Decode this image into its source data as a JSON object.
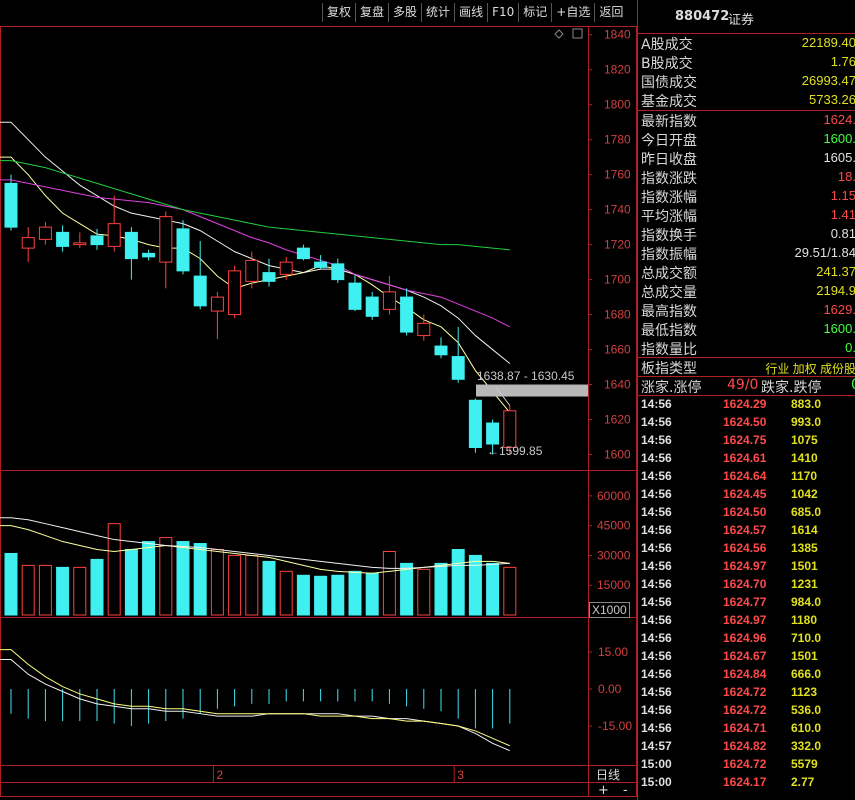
{
  "toolbar": [
    "复权",
    "复盘",
    "多股",
    "统计",
    "画线",
    "F10",
    "标记",
    "+自选",
    "返回"
  ],
  "chart_data": {
    "type": "candlestick",
    "price_axis": {
      "ticks": [
        1840,
        1820,
        1800,
        1780,
        1760,
        1740,
        1720,
        1700,
        1680,
        1660,
        1640,
        1620,
        1600
      ],
      "range": [
        1594,
        1845
      ]
    },
    "candles": [
      {
        "o": 1730,
        "c": 1755,
        "h": 1760,
        "l": 1728,
        "dir": "up"
      },
      {
        "o": 1718,
        "c": 1724,
        "h": 1730,
        "l": 1710,
        "dir": "down"
      },
      {
        "o": 1723,
        "c": 1730,
        "h": 1733,
        "l": 1720,
        "dir": "down"
      },
      {
        "o": 1727,
        "c": 1719,
        "h": 1731,
        "l": 1716,
        "dir": "up"
      },
      {
        "o": 1721,
        "c": 1720,
        "h": 1727,
        "l": 1718,
        "dir": "down"
      },
      {
        "o": 1725,
        "c": 1720,
        "h": 1729,
        "l": 1717,
        "dir": "up"
      },
      {
        "o": 1719,
        "c": 1732,
        "h": 1748,
        "l": 1716,
        "dir": "down"
      },
      {
        "o": 1727,
        "c": 1712,
        "h": 1730,
        "l": 1700,
        "dir": "up"
      },
      {
        "o": 1713,
        "c": 1715,
        "h": 1717,
        "l": 1711,
        "dir": "up"
      },
      {
        "o": 1710,
        "c": 1736,
        "h": 1739,
        "l": 1695,
        "dir": "down"
      },
      {
        "o": 1729,
        "c": 1705,
        "h": 1734,
        "l": 1703,
        "dir": "up"
      },
      {
        "o": 1702,
        "c": 1685,
        "h": 1722,
        "l": 1683,
        "dir": "up"
      },
      {
        "o": 1682,
        "c": 1690,
        "h": 1693,
        "l": 1666,
        "dir": "down"
      },
      {
        "o": 1680,
        "c": 1705,
        "h": 1708,
        "l": 1678,
        "dir": "down"
      },
      {
        "o": 1699,
        "c": 1711,
        "h": 1716,
        "l": 1695,
        "dir": "down"
      },
      {
        "o": 1704,
        "c": 1699,
        "h": 1712,
        "l": 1696,
        "dir": "up"
      },
      {
        "o": 1703,
        "c": 1710,
        "h": 1713,
        "l": 1700,
        "dir": "down"
      },
      {
        "o": 1718,
        "c": 1712,
        "h": 1720,
        "l": 1711,
        "dir": "up"
      },
      {
        "o": 1710,
        "c": 1707,
        "h": 1714,
        "l": 1706,
        "dir": "up"
      },
      {
        "o": 1709,
        "c": 1700,
        "h": 1712,
        "l": 1698,
        "dir": "up"
      },
      {
        "o": 1698,
        "c": 1683,
        "h": 1703,
        "l": 1682,
        "dir": "up"
      },
      {
        "o": 1690,
        "c": 1679,
        "h": 1693,
        "l": 1677,
        "dir": "up"
      },
      {
        "o": 1683,
        "c": 1693,
        "h": 1702,
        "l": 1680,
        "dir": "down"
      },
      {
        "o": 1690,
        "c": 1670,
        "h": 1695,
        "l": 1668,
        "dir": "up"
      },
      {
        "o": 1668,
        "c": 1675,
        "h": 1680,
        "l": 1665,
        "dir": "down"
      },
      {
        "o": 1662,
        "c": 1657,
        "h": 1667,
        "l": 1655,
        "dir": "up"
      },
      {
        "o": 1656,
        "c": 1643,
        "h": 1673,
        "l": 1641,
        "dir": "up"
      },
      {
        "o": 1631,
        "c": 1604,
        "h": 1632,
        "l": 1601,
        "dir": "up"
      },
      {
        "o": 1618,
        "c": 1606,
        "h": 1620,
        "l": 1600,
        "dir": "up"
      },
      {
        "o": 1604,
        "c": 1625,
        "h": 1628,
        "l": 1600,
        "dir": "down"
      }
    ],
    "ma_lines": {
      "ma5": [
        1770,
        1760,
        1748,
        1738,
        1732,
        1726,
        1725,
        1723,
        1720,
        1718,
        1718,
        1712,
        1702,
        1695,
        1698,
        1700,
        1702,
        1704,
        1708,
        1706,
        1703,
        1697,
        1690,
        1684,
        1677,
        1673,
        1664,
        1648,
        1636,
        1624
      ],
      "ma10": [
        1790,
        1780,
        1770,
        1762,
        1754,
        1748,
        1742,
        1738,
        1736,
        1734,
        1732,
        1728,
        1722,
        1716,
        1712,
        1708,
        1706,
        1704,
        1706,
        1706,
        1703,
        1700,
        1697,
        1694,
        1690,
        1685,
        1678,
        1668,
        1660,
        1652
      ],
      "ma20": [
        1757,
        1755,
        1753,
        1751,
        1749,
        1747,
        1746,
        1745,
        1744,
        1742,
        1740,
        1736,
        1732,
        1728,
        1724,
        1721,
        1717,
        1714,
        1711,
        1708,
        1703,
        1700,
        1697,
        1694,
        1692,
        1690,
        1686,
        1682,
        1678,
        1673
      ],
      "ma60": [
        1768,
        1766,
        1764,
        1761,
        1758,
        1755,
        1752,
        1749,
        1746,
        1743,
        1740,
        1738,
        1736,
        1734,
        1732,
        1730,
        1729,
        1728,
        1727,
        1726,
        1725,
        1724,
        1723,
        1722,
        1721,
        1720,
        1720,
        1719,
        1718,
        1717
      ]
    },
    "annotations": {
      "range": "1638.87 - 1630.45",
      "low": "1599.85",
      "range_values": [
        1630.45,
        1638.87
      ],
      "low_value": 1599.85
    },
    "volume": {
      "ticks": [
        60000,
        45000,
        30000,
        15000
      ],
      "unit": "X1000",
      "range": [
        0,
        68000
      ],
      "values": [
        31000,
        25000,
        25000,
        24000,
        24000,
        28000,
        46000,
        33000,
        37000,
        39000,
        37000,
        36000,
        33000,
        30000,
        30000,
        27000,
        22000,
        20000,
        19500,
        20000,
        22000,
        21000,
        32000,
        26000,
        23000,
        26000,
        33000,
        30000,
        26000,
        24000
      ],
      "ma1": [
        45000,
        43000,
        40000,
        37000,
        35000,
        33000,
        32000,
        33000,
        34000,
        35000,
        34000,
        33000,
        32000,
        31000,
        30000,
        29000,
        27000,
        25000,
        23000,
        22000,
        21500,
        21000,
        22000,
        23000,
        24000,
        25000,
        26000,
        27000,
        27000,
        26000
      ],
      "ma2": [
        49000,
        48000,
        46000,
        44000,
        42000,
        40000,
        38000,
        37000,
        36000,
        35000,
        34500,
        34000,
        33000,
        32000,
        31000,
        30000,
        29000,
        28000,
        27000,
        26000,
        25000,
        24000,
        23500,
        23500,
        24000,
        24500,
        25000,
        25000,
        25500,
        26000
      ]
    },
    "macd": {
      "ticks": [
        15.0,
        0.0,
        -15.0
      ],
      "tick_labels": [
        "15.00",
        "0.00",
        "-15.00"
      ],
      "range": [
        -30,
        28
      ],
      "hist": [
        -10,
        -12,
        -13,
        -13,
        -13,
        -13,
        -14,
        -15,
        -14,
        -13,
        -12,
        -10,
        -8,
        -7,
        -6,
        -6,
        -5,
        -5,
        -5,
        -5,
        -5,
        -5,
        -6,
        -7,
        -8,
        -9,
        -12,
        -16,
        -16,
        -14
      ],
      "dif": [
        12,
        6,
        2,
        -1,
        -4,
        -6,
        -7,
        -8,
        -8,
        -9,
        -9,
        -10,
        -11,
        -11,
        -11,
        -10,
        -10,
        -10,
        -10,
        -10,
        -11,
        -11,
        -12,
        -12,
        -13,
        -14,
        -15,
        -18,
        -22,
        -25
      ],
      "dea": [
        16,
        10,
        5,
        1,
        -2,
        -4,
        -6,
        -7,
        -7,
        -8,
        -8,
        -9,
        -10,
        -10,
        -10,
        -10,
        -10,
        -10,
        -11,
        -11,
        -11,
        -12,
        -12,
        -13,
        -13,
        -14,
        -15,
        -17,
        -20,
        -23
      ]
    },
    "x_labels": [
      {
        "label": "2",
        "index": 12
      },
      {
        "label": "3",
        "index": 26
      }
    ]
  },
  "bottom": {
    "period": "日线",
    "plus": "+",
    "minus": "-"
  },
  "panel": {
    "code": "880472",
    "name": "证券",
    "market": [
      {
        "label": "A股成交",
        "value": "22189.40",
        "color": "#e0e020"
      },
      {
        "label": "B股成交",
        "value": "1.76",
        "color": "#e0e020"
      },
      {
        "label": "国债成交",
        "value": "26993.47",
        "color": "#e0e020"
      },
      {
        "label": "基金成交",
        "value": "5733.26",
        "color": "#e0e020"
      }
    ],
    "index": [
      {
        "label": "最新指数",
        "value": "1624.",
        "color": "#ff4a4a"
      },
      {
        "label": "今日开盘",
        "value": "1600.",
        "color": "#40ff40"
      },
      {
        "label": "昨日收盘",
        "value": "1605.",
        "color": "#e0e0e0"
      },
      {
        "label": "指数涨跌",
        "value": "18.",
        "color": "#ff4a4a"
      },
      {
        "label": "指数涨幅",
        "value": "1.15",
        "color": "#ff4a4a"
      },
      {
        "label": "平均涨幅",
        "value": "1.41",
        "color": "#ff4a4a"
      },
      {
        "label": "指数换手",
        "value": "0.81",
        "color": "#e0e0e0"
      },
      {
        "label": "指数振幅",
        "value": "29.51/1.84",
        "color": "#e0e0e0"
      },
      {
        "label": "总成交额",
        "value": "241.37",
        "color": "#e0e020"
      },
      {
        "label": "总成交量",
        "value": "2194.9",
        "color": "#e0e020"
      },
      {
        "label": "最高指数",
        "value": "1629.",
        "color": "#ff4a4a"
      },
      {
        "label": "最低指数",
        "value": "1600.",
        "color": "#40ff40"
      },
      {
        "label": "指数量比",
        "value": "0.",
        "color": "#40ff40"
      }
    ],
    "board": {
      "label": "板指类型",
      "value": "行业 加权 成份股",
      "color": "#e0e020"
    },
    "breadth": {
      "up_label": "涨家.涨停",
      "up_value": "49/0",
      "down_label": "跌家.跌停",
      "down_value": "0"
    },
    "ticks": [
      {
        "t": "14:56",
        "p": "1624.29",
        "v": "883.0"
      },
      {
        "t": "14:56",
        "p": "1624.50",
        "v": "993.0"
      },
      {
        "t": "14:56",
        "p": "1624.75",
        "v": "1075"
      },
      {
        "t": "14:56",
        "p": "1624.61",
        "v": "1410"
      },
      {
        "t": "14:56",
        "p": "1624.64",
        "v": "1170"
      },
      {
        "t": "14:56",
        "p": "1624.45",
        "v": "1042"
      },
      {
        "t": "14:56",
        "p": "1624.50",
        "v": "685.0"
      },
      {
        "t": "14:56",
        "p": "1624.57",
        "v": "1614"
      },
      {
        "t": "14:56",
        "p": "1624.56",
        "v": "1385"
      },
      {
        "t": "14:56",
        "p": "1624.97",
        "v": "1501"
      },
      {
        "t": "14:56",
        "p": "1624.70",
        "v": "1231"
      },
      {
        "t": "14:56",
        "p": "1624.77",
        "v": "984.0"
      },
      {
        "t": "14:56",
        "p": "1624.97",
        "v": "1180"
      },
      {
        "t": "14:56",
        "p": "1624.96",
        "v": "710.0"
      },
      {
        "t": "14:56",
        "p": "1624.67",
        "v": "1501"
      },
      {
        "t": "14:56",
        "p": "1624.84",
        "v": "666.0"
      },
      {
        "t": "14:56",
        "p": "1624.72",
        "v": "1123"
      },
      {
        "t": "14:56",
        "p": "1624.72",
        "v": "536.0"
      },
      {
        "t": "14:56",
        "p": "1624.71",
        "v": "610.0"
      },
      {
        "t": "14:57",
        "p": "1624.82",
        "v": "332.0"
      },
      {
        "t": "15:00",
        "p": "1624.72",
        "v": "5579"
      },
      {
        "t": "15:00",
        "p": "1624.17",
        "v": "2.77"
      }
    ]
  }
}
